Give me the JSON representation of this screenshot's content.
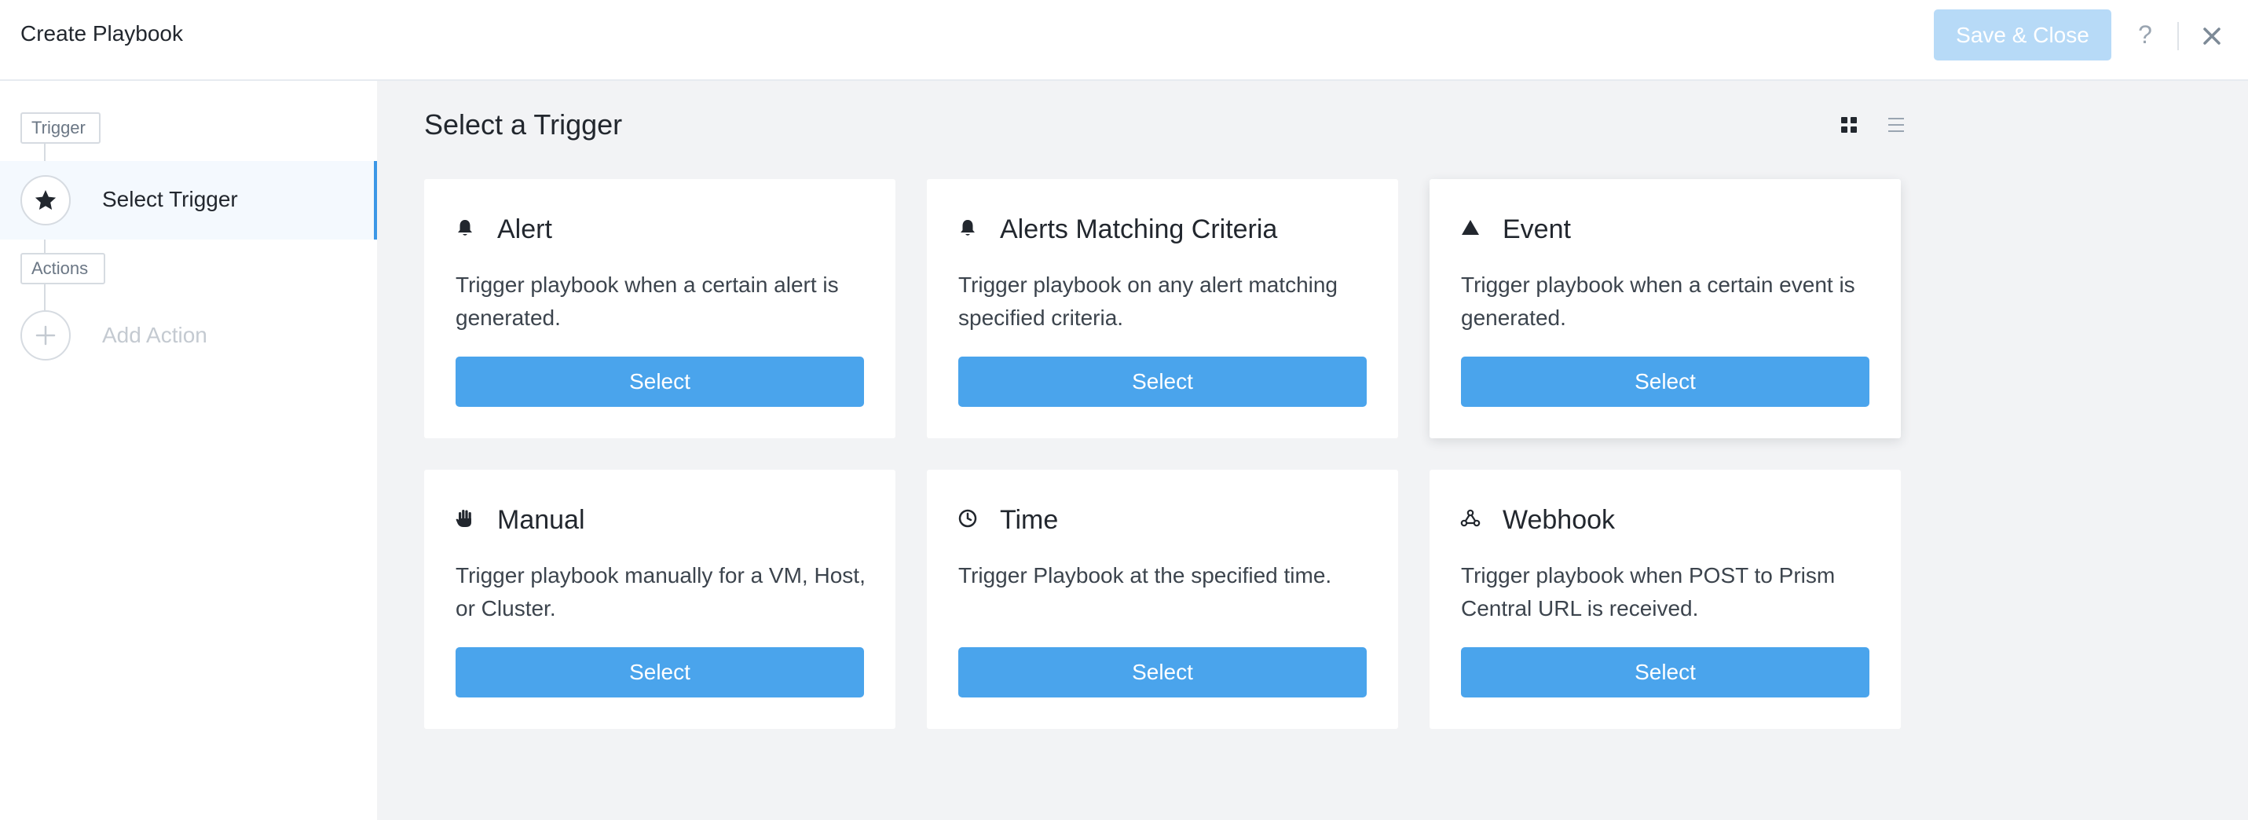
{
  "header": {
    "title": "Create Playbook",
    "save_label": "Save & Close",
    "help_label": "?",
    "close_icon": "close-icon"
  },
  "sidebar": {
    "trigger_tag": "Trigger",
    "trigger_step": {
      "label": "Select Trigger",
      "icon": "star-icon"
    },
    "actions_tag": "Actions",
    "action_step": {
      "label": "Add Action",
      "icon": "plus-icon"
    }
  },
  "main": {
    "title": "Select a Trigger",
    "view_toggle": {
      "active": "grid",
      "options": [
        "grid-view-icon",
        "list-view-icon"
      ]
    },
    "cards": [
      {
        "icon": "bell-icon",
        "title": "Alert",
        "description": "Trigger playbook when a certain alert is generated.",
        "button": "Select"
      },
      {
        "icon": "bell-icon",
        "title": "Alerts Matching Criteria",
        "description": "Trigger playbook on any alert matching specified criteria.",
        "button": "Select"
      },
      {
        "icon": "triangle-icon",
        "title": "Event",
        "description": "Trigger playbook when a certain event is generated.",
        "button": "Select"
      },
      {
        "icon": "hand-icon",
        "title": "Manual",
        "description": "Trigger playbook manually for a VM, Host, or Cluster.",
        "button": "Select"
      },
      {
        "icon": "clock-icon",
        "title": "Time",
        "description": "Trigger Playbook at the specified time.",
        "button": "Select"
      },
      {
        "icon": "webhook-icon",
        "title": "Webhook",
        "description": "Trigger playbook when POST to Prism Central URL is received.",
        "button": "Select"
      }
    ]
  },
  "colors": {
    "accent": "#4aa4ec",
    "accent_disabled": "#b7daf7",
    "active_border": "#3b97e6",
    "main_background": "#f2f3f5"
  }
}
